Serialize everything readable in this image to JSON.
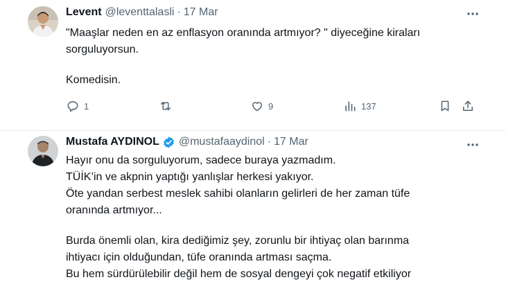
{
  "tweets": [
    {
      "name": "Levent",
      "handle": "@leventtalasli",
      "separator": "·",
      "date": "17 Mar",
      "lines": [
        "\"Maaşlar neden en az enflasyon oranında artmıyor? \" diyeceğine kiraları",
        "sorguluyorsun.",
        "",
        "Komedisin."
      ],
      "actions": {
        "reply": {
          "icon": "reply-icon",
          "count": "1"
        },
        "retweet": {
          "icon": "retweet-icon",
          "count": ""
        },
        "like": {
          "icon": "like-icon",
          "count": "9"
        },
        "views": {
          "icon": "views-icon",
          "count": "137"
        },
        "bookmark": {
          "icon": "bookmark-icon"
        },
        "share": {
          "icon": "share-icon"
        }
      }
    },
    {
      "name": "Mustafa AYDINOL",
      "verified": true,
      "handle": "@mustafaaydinol",
      "separator": "·",
      "date": "17 Mar",
      "lines": [
        "Hayır onu da sorguluyorum, sadece buraya yazmadım.",
        "TÜİK’in ve akpnin yaptığı yanlışlar herkesi yakıyor.",
        "Öte yandan serbest meslek sahibi olanların gelirleri de her zaman tüfe",
        "oranında artmıyor...",
        "",
        "Burda önemli olan, kira dediğimiz şey, zorunlu bir ihtiyaç olan barınma",
        "ihtiyacı için olduğundan, tüfe oranında artması saçma.",
        "Bu hem sürdürülebilir değil hem de sosyal dengeyi çok negatif etkiliyor"
      ]
    }
  ],
  "colors": {
    "text": "#0f1419",
    "secondary": "#536471",
    "verified": "#1d9bf0",
    "divider": "#e7e9ea"
  }
}
